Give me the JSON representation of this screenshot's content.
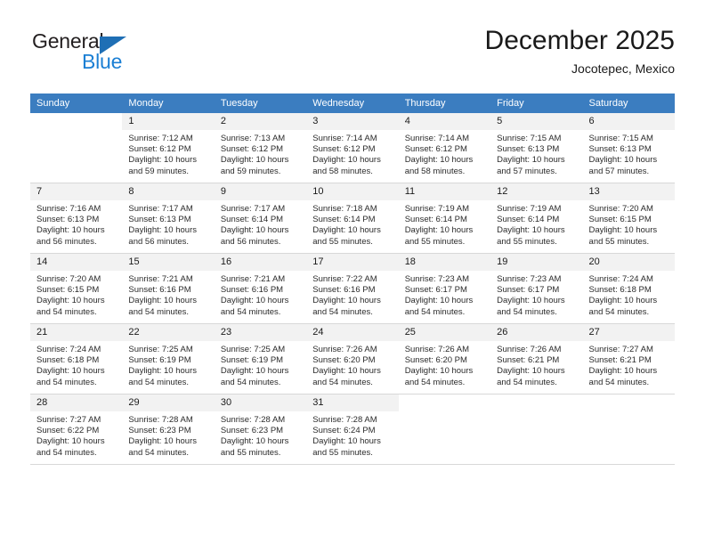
{
  "brand": {
    "name_top": "General",
    "name_bottom": "Blue",
    "accent_color": "#1b7fd4",
    "triangle_color": "#1f6fb5"
  },
  "header": {
    "title": "December 2025",
    "location": "Jocotepec, Mexico"
  },
  "calendar": {
    "header_color": "#3b7dc0",
    "daynum_band_color": "#f2f2f2",
    "weekday_headers": [
      "Sunday",
      "Monday",
      "Tuesday",
      "Wednesday",
      "Thursday",
      "Friday",
      "Saturday"
    ],
    "weeks": [
      [
        {
          "day": "",
          "blank": true
        },
        {
          "day": "1",
          "sunrise": "Sunrise: 7:12 AM",
          "sunset": "Sunset: 6:12 PM",
          "daylight_line1": "Daylight: 10 hours",
          "daylight_line2": "and 59 minutes."
        },
        {
          "day": "2",
          "sunrise": "Sunrise: 7:13 AM",
          "sunset": "Sunset: 6:12 PM",
          "daylight_line1": "Daylight: 10 hours",
          "daylight_line2": "and 59 minutes."
        },
        {
          "day": "3",
          "sunrise": "Sunrise: 7:14 AM",
          "sunset": "Sunset: 6:12 PM",
          "daylight_line1": "Daylight: 10 hours",
          "daylight_line2": "and 58 minutes."
        },
        {
          "day": "4",
          "sunrise": "Sunrise: 7:14 AM",
          "sunset": "Sunset: 6:12 PM",
          "daylight_line1": "Daylight: 10 hours",
          "daylight_line2": "and 58 minutes."
        },
        {
          "day": "5",
          "sunrise": "Sunrise: 7:15 AM",
          "sunset": "Sunset: 6:13 PM",
          "daylight_line1": "Daylight: 10 hours",
          "daylight_line2": "and 57 minutes."
        },
        {
          "day": "6",
          "sunrise": "Sunrise: 7:15 AM",
          "sunset": "Sunset: 6:13 PM",
          "daylight_line1": "Daylight: 10 hours",
          "daylight_line2": "and 57 minutes."
        }
      ],
      [
        {
          "day": "7",
          "sunrise": "Sunrise: 7:16 AM",
          "sunset": "Sunset: 6:13 PM",
          "daylight_line1": "Daylight: 10 hours",
          "daylight_line2": "and 56 minutes."
        },
        {
          "day": "8",
          "sunrise": "Sunrise: 7:17 AM",
          "sunset": "Sunset: 6:13 PM",
          "daylight_line1": "Daylight: 10 hours",
          "daylight_line2": "and 56 minutes."
        },
        {
          "day": "9",
          "sunrise": "Sunrise: 7:17 AM",
          "sunset": "Sunset: 6:14 PM",
          "daylight_line1": "Daylight: 10 hours",
          "daylight_line2": "and 56 minutes."
        },
        {
          "day": "10",
          "sunrise": "Sunrise: 7:18 AM",
          "sunset": "Sunset: 6:14 PM",
          "daylight_line1": "Daylight: 10 hours",
          "daylight_line2": "and 55 minutes."
        },
        {
          "day": "11",
          "sunrise": "Sunrise: 7:19 AM",
          "sunset": "Sunset: 6:14 PM",
          "daylight_line1": "Daylight: 10 hours",
          "daylight_line2": "and 55 minutes."
        },
        {
          "day": "12",
          "sunrise": "Sunrise: 7:19 AM",
          "sunset": "Sunset: 6:14 PM",
          "daylight_line1": "Daylight: 10 hours",
          "daylight_line2": "and 55 minutes."
        },
        {
          "day": "13",
          "sunrise": "Sunrise: 7:20 AM",
          "sunset": "Sunset: 6:15 PM",
          "daylight_line1": "Daylight: 10 hours",
          "daylight_line2": "and 55 minutes."
        }
      ],
      [
        {
          "day": "14",
          "sunrise": "Sunrise: 7:20 AM",
          "sunset": "Sunset: 6:15 PM",
          "daylight_line1": "Daylight: 10 hours",
          "daylight_line2": "and 54 minutes."
        },
        {
          "day": "15",
          "sunrise": "Sunrise: 7:21 AM",
          "sunset": "Sunset: 6:16 PM",
          "daylight_line1": "Daylight: 10 hours",
          "daylight_line2": "and 54 minutes."
        },
        {
          "day": "16",
          "sunrise": "Sunrise: 7:21 AM",
          "sunset": "Sunset: 6:16 PM",
          "daylight_line1": "Daylight: 10 hours",
          "daylight_line2": "and 54 minutes."
        },
        {
          "day": "17",
          "sunrise": "Sunrise: 7:22 AM",
          "sunset": "Sunset: 6:16 PM",
          "daylight_line1": "Daylight: 10 hours",
          "daylight_line2": "and 54 minutes."
        },
        {
          "day": "18",
          "sunrise": "Sunrise: 7:23 AM",
          "sunset": "Sunset: 6:17 PM",
          "daylight_line1": "Daylight: 10 hours",
          "daylight_line2": "and 54 minutes."
        },
        {
          "day": "19",
          "sunrise": "Sunrise: 7:23 AM",
          "sunset": "Sunset: 6:17 PM",
          "daylight_line1": "Daylight: 10 hours",
          "daylight_line2": "and 54 minutes."
        },
        {
          "day": "20",
          "sunrise": "Sunrise: 7:24 AM",
          "sunset": "Sunset: 6:18 PM",
          "daylight_line1": "Daylight: 10 hours",
          "daylight_line2": "and 54 minutes."
        }
      ],
      [
        {
          "day": "21",
          "sunrise": "Sunrise: 7:24 AM",
          "sunset": "Sunset: 6:18 PM",
          "daylight_line1": "Daylight: 10 hours",
          "daylight_line2": "and 54 minutes."
        },
        {
          "day": "22",
          "sunrise": "Sunrise: 7:25 AM",
          "sunset": "Sunset: 6:19 PM",
          "daylight_line1": "Daylight: 10 hours",
          "daylight_line2": "and 54 minutes."
        },
        {
          "day": "23",
          "sunrise": "Sunrise: 7:25 AM",
          "sunset": "Sunset: 6:19 PM",
          "daylight_line1": "Daylight: 10 hours",
          "daylight_line2": "and 54 minutes."
        },
        {
          "day": "24",
          "sunrise": "Sunrise: 7:26 AM",
          "sunset": "Sunset: 6:20 PM",
          "daylight_line1": "Daylight: 10 hours",
          "daylight_line2": "and 54 minutes."
        },
        {
          "day": "25",
          "sunrise": "Sunrise: 7:26 AM",
          "sunset": "Sunset: 6:20 PM",
          "daylight_line1": "Daylight: 10 hours",
          "daylight_line2": "and 54 minutes."
        },
        {
          "day": "26",
          "sunrise": "Sunrise: 7:26 AM",
          "sunset": "Sunset: 6:21 PM",
          "daylight_line1": "Daylight: 10 hours",
          "daylight_line2": "and 54 minutes."
        },
        {
          "day": "27",
          "sunrise": "Sunrise: 7:27 AM",
          "sunset": "Sunset: 6:21 PM",
          "daylight_line1": "Daylight: 10 hours",
          "daylight_line2": "and 54 minutes."
        }
      ],
      [
        {
          "day": "28",
          "sunrise": "Sunrise: 7:27 AM",
          "sunset": "Sunset: 6:22 PM",
          "daylight_line1": "Daylight: 10 hours",
          "daylight_line2": "and 54 minutes."
        },
        {
          "day": "29",
          "sunrise": "Sunrise: 7:28 AM",
          "sunset": "Sunset: 6:23 PM",
          "daylight_line1": "Daylight: 10 hours",
          "daylight_line2": "and 54 minutes."
        },
        {
          "day": "30",
          "sunrise": "Sunrise: 7:28 AM",
          "sunset": "Sunset: 6:23 PM",
          "daylight_line1": "Daylight: 10 hours",
          "daylight_line2": "and 55 minutes."
        },
        {
          "day": "31",
          "sunrise": "Sunrise: 7:28 AM",
          "sunset": "Sunset: 6:24 PM",
          "daylight_line1": "Daylight: 10 hours",
          "daylight_line2": "and 55 minutes."
        },
        {
          "day": "",
          "blank": true
        },
        {
          "day": "",
          "blank": true
        },
        {
          "day": "",
          "blank": true
        }
      ]
    ]
  }
}
